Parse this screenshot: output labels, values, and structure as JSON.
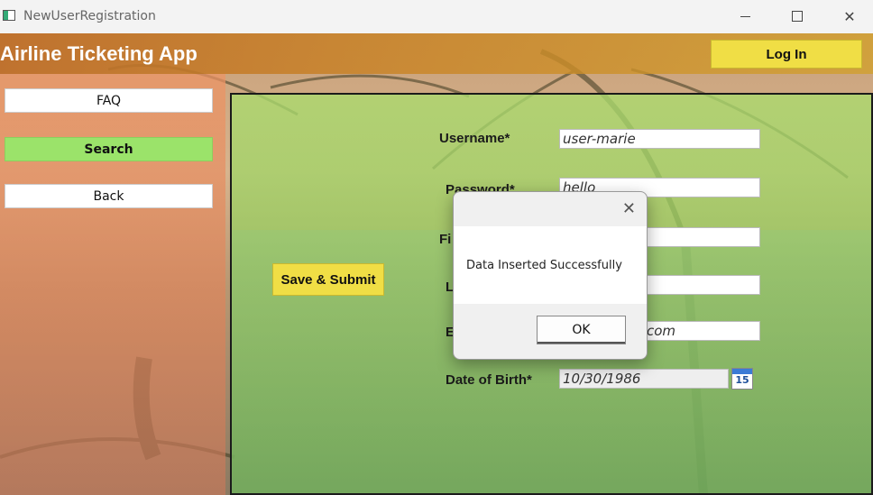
{
  "window": {
    "title": "NewUserRegistration"
  },
  "header": {
    "app_title": "Airline Ticketing App",
    "login_label": "Log In"
  },
  "nav": {
    "faq": "FAQ",
    "search": "Search",
    "back": "Back"
  },
  "form": {
    "username_label": "Username*",
    "username_value": "user-marie",
    "password_label": "Password*",
    "password_value": "hello",
    "first_name_label_visible": "Fi",
    "last_name_label_visible": "L",
    "email_label_visible": "E",
    "email_value_visible": "com",
    "dob_label": "Date of Birth*",
    "dob_value": "10/30/1986",
    "calendar_day": "15",
    "save_label": "Save & Submit"
  },
  "dialog": {
    "close_glyph": "✕",
    "message": "Data Inserted Successfully",
    "ok_label": "OK"
  },
  "colors": {
    "accent_yellow": "#f0de45",
    "nav_active": "#9be36a"
  }
}
